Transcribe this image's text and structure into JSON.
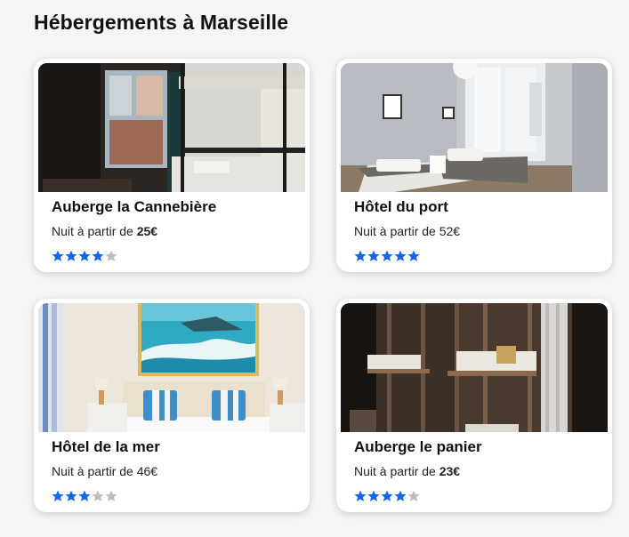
{
  "section": {
    "title": "Hébergements à Marseille"
  },
  "price_prefix": "Nuit à partir de",
  "colors": {
    "star_filled": "#1766e5",
    "star_empty": "#bdbdbd"
  },
  "cards": [
    {
      "name": "Auberge la Cannebière",
      "price": "25€",
      "price_bold": true,
      "rating": 4,
      "photo": "hostel-dorm-bunk-beds-window"
    },
    {
      "name": "Hôtel du port",
      "price": "52€",
      "price_bold": false,
      "rating": 5,
      "photo": "hotel-room-twin-beds-grey"
    },
    {
      "name": "Hôtel de la mer",
      "price": "46€",
      "price_bold": false,
      "rating": 3,
      "photo": "hotel-room-wave-painting"
    },
    {
      "name": "Auberge le panier",
      "price": "23€",
      "price_bold": true,
      "rating": 4,
      "photo": "hostel-wooden-bunk-beds"
    }
  ]
}
